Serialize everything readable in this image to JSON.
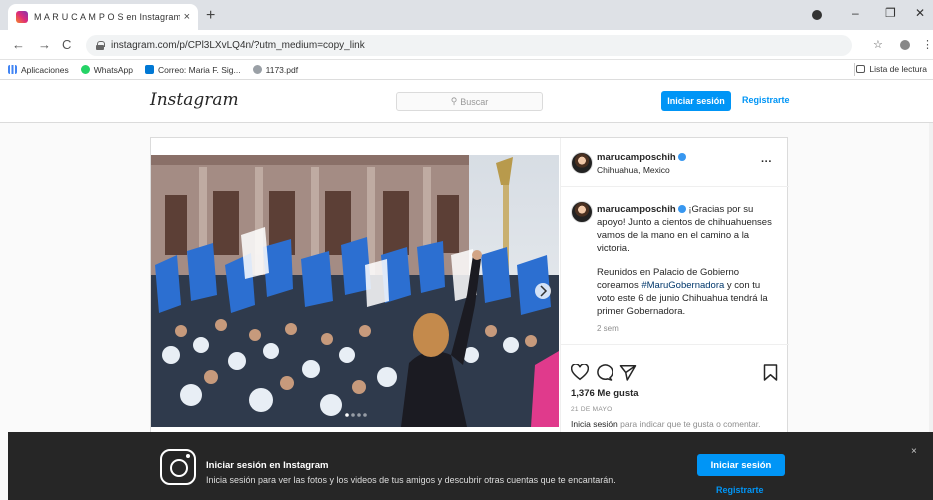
{
  "browser": {
    "tab_title": "M A R U C A M P O S en Instagram",
    "tab_close": "×",
    "new_tab": "+",
    "url": "instagram.com/p/CPl3LXvLQ4n/?utm_medium=copy_link",
    "controls": {
      "minimize": "–",
      "restore": "❐",
      "close": "✕"
    },
    "nav": {
      "back": "←",
      "forward": "→",
      "reload": "C"
    },
    "star": "☆",
    "menu": "⋮"
  },
  "bookmarks": {
    "items": [
      {
        "label": "Aplicaciones",
        "color": "#4285f4"
      },
      {
        "label": "WhatsApp",
        "color": "#25d366"
      },
      {
        "label": "Correo: Maria F. Sig...",
        "color": "#0078d4"
      },
      {
        "label": "1173.pdf",
        "color": "#9aa0a6"
      }
    ],
    "reading_list": "Lista de lectura"
  },
  "instagram": {
    "logo": "Instagram",
    "search_placeholder": "Buscar",
    "login_button": "Iniciar sesión",
    "signup_link": "Registrarte",
    "accent_color": "#0095f6"
  },
  "post": {
    "author": "marucamposchih",
    "location": "Chihuahua, Mexico",
    "more": "···",
    "caption_author": "marucamposchih",
    "caption_text": "¡Gracias por su apoyo! Junto a cientos de chihuahuenses vamos de la mano en el camino a la victoria.",
    "caption2_a": "Reunidos en Palacio de Gobierno coreamos ",
    "caption2_hashtag": "#MaruGobernadora",
    "caption2_b": " y con tu voto este 6 de junio Chihuahua tendrá la primer Gobernadora.",
    "time_ago": "2 sem",
    "likes": "1,376 Me gusta",
    "date": "21 DE MAYO",
    "login_prompt_link": "Inicia sesión",
    "login_prompt_text": " para indicar que te gusta o comentar."
  },
  "banner": {
    "title": "Iniciar sesión en Instagram",
    "subtitle": "Inicia sesión para ver las fotos y los videos de tus amigos y descubrir otras cuentas que te encantarán.",
    "login_button": "Iniciar sesión",
    "signup_link": "Registrarte",
    "close": "×"
  }
}
